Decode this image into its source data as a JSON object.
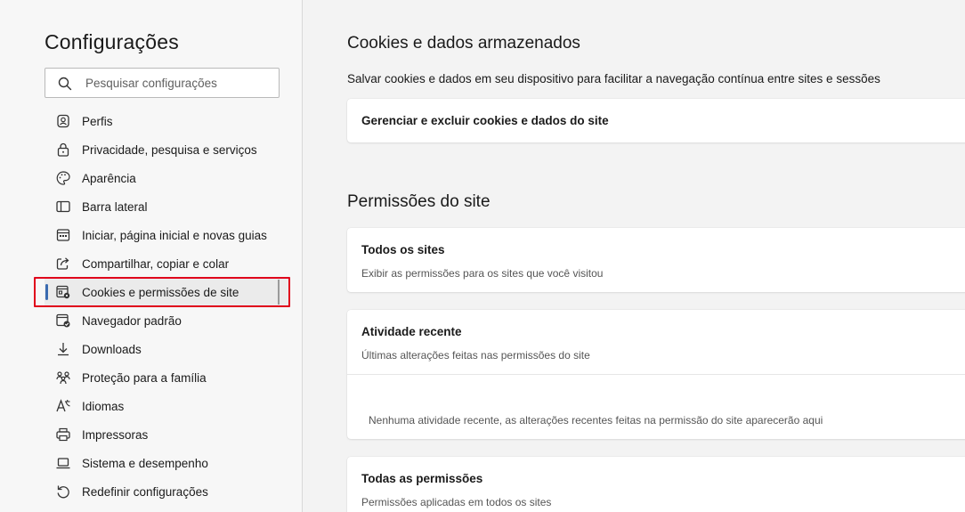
{
  "sidebar": {
    "title": "Configurações",
    "search_placeholder": "Pesquisar configurações",
    "items": [
      {
        "label": "Perfis",
        "icon": "profile-icon"
      },
      {
        "label": "Privacidade, pesquisa e serviços",
        "icon": "lock-icon"
      },
      {
        "label": "Aparência",
        "icon": "palette-icon"
      },
      {
        "label": "Barra lateral",
        "icon": "sidebar-icon"
      },
      {
        "label": "Iniciar, página inicial e novas guias",
        "icon": "home-tabs-icon"
      },
      {
        "label": "Compartilhar, copiar e colar",
        "icon": "share-icon"
      },
      {
        "label": "Cookies e permissões de site",
        "icon": "cookies-permissions-icon",
        "active": true
      },
      {
        "label": "Navegador padrão",
        "icon": "default-browser-icon"
      },
      {
        "label": "Downloads",
        "icon": "download-icon"
      },
      {
        "label": "Proteção para a família",
        "icon": "family-icon"
      },
      {
        "label": "Idiomas",
        "icon": "languages-icon"
      },
      {
        "label": "Impressoras",
        "icon": "printer-icon"
      },
      {
        "label": "Sistema e desempenho",
        "icon": "laptop-icon"
      },
      {
        "label": "Redefinir configurações",
        "icon": "reset-icon"
      }
    ]
  },
  "main": {
    "cookies_section": {
      "title": "Cookies e dados armazenados",
      "description": "Salvar cookies e dados em seu dispositivo para facilitar a navegação contínua entre sites e sessões",
      "manage_label": "Gerenciar e excluir cookies e dados do site"
    },
    "permissions_section": {
      "title": "Permissões do site",
      "all_sites": {
        "title": "Todos os sites",
        "subtitle": "Exibir as permissões para os sites que você visitou"
      },
      "recent_activity": {
        "title": "Atividade recente",
        "subtitle": "Últimas alterações feitas nas permissões do site",
        "empty": "Nenhuma atividade recente, as alterações recentes feitas na permissão do site aparecerão aqui"
      },
      "all_permissions": {
        "title": "Todas as permissões",
        "subtitle": "Permissões aplicadas em todos os sites"
      }
    }
  },
  "colors": {
    "active_indicator": "#3a6ab0",
    "highlight_border": "#e0001b"
  }
}
